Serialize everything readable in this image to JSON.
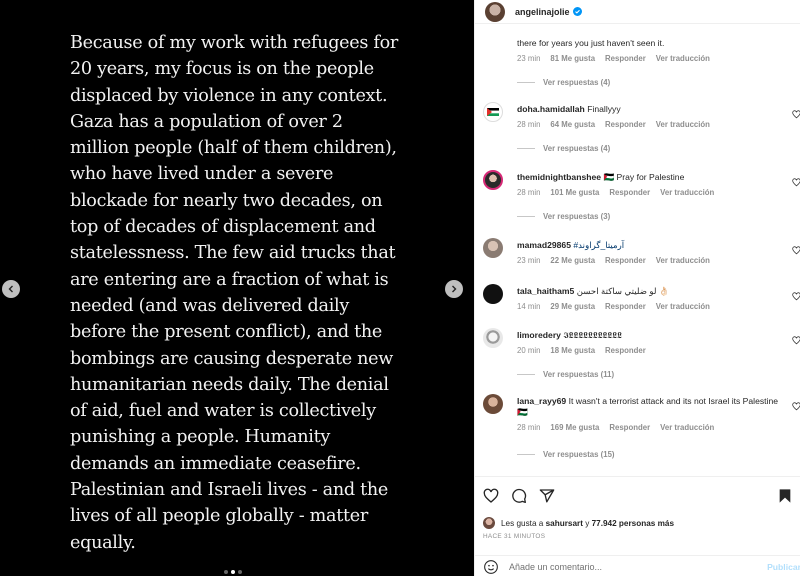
{
  "post": {
    "text": "Because of my work with refugees for 20 years, my focus is on the people displaced by violence in any context. Gaza has a population of over 2 million people (half of them children), who have lived under a severe blockade for nearly two decades, on top of decades of displacement and statelessness. The few aid trucks that are entering are a fraction of what is needed (and was delivered daily before the present conflict), and the bombings are causing desperate new humanitarian needs daily. The denial of aid, fuel and water is collectively punishing a people. Humanity demands an immediate ceasefire. Palestinian and Israeli lives - and the lives of all people globally - matter equally."
  },
  "header": {
    "username": "angelinajolie"
  },
  "labels": {
    "reply": "Responder",
    "translate": "Ver traducción"
  },
  "comments": [
    {
      "user": "",
      "text": "there for years you just haven't seen it.",
      "time": "23 min",
      "likes": "81 Me gusta",
      "translate": true,
      "replies": "Ver respuestas (4)"
    },
    {
      "user": "doha.hamidallah",
      "text": "Finallyyy",
      "time": "28 min",
      "likes": "64 Me gusta",
      "translate": true,
      "replies": "Ver respuestas (4)"
    },
    {
      "user": "themidnightbanshee",
      "text": "🇵🇸 Pray for Palestine",
      "time": "28 min",
      "likes": "101 Me gusta",
      "translate": true,
      "replies": "Ver respuestas (3)"
    },
    {
      "user": "mamad29865",
      "text": "#آرمیتا_گراوند",
      "time": "23 min",
      "likes": "22 Me gusta",
      "translate": true,
      "replies": ""
    },
    {
      "user": "tala_haitham5",
      "text": "لو ضليتي ساكتة احسن 👌🏻",
      "time": "14 min",
      "likes": "29 Me gusta",
      "translate": true,
      "replies": ""
    },
    {
      "user": "limoredery",
      "text": "𝕴𝕷𝕷𝕷𝕷𝕷𝕷𝕷𝕷𝕷𝕷𝕷",
      "time": "20 min",
      "likes": "18 Me gusta",
      "translate": false,
      "replies": "Ver respuestas (11)"
    },
    {
      "user": "lana_rayy69",
      "text": "It wasn't a terrorist attack and its not Israel its Palestine 🇵🇸",
      "time": "28 min",
      "likes": "169 Me gusta",
      "translate": true,
      "replies": "Ver respuestas (15)"
    }
  ],
  "likes_bar": {
    "prefix": "Les gusta a",
    "user": "sahursart",
    "middle": "y",
    "count": "77.942 personas más"
  },
  "time_ago": "HACE 31 MINUTOS",
  "add_comment": {
    "placeholder": "Añade un comentario...",
    "publish": "Publicar"
  },
  "icons": {
    "prev": "chevron-left-icon",
    "next": "chevron-right-icon",
    "verified": "verified-badge-icon",
    "like": "heart-icon",
    "comment": "comment-bubble-icon",
    "share": "send-icon",
    "save": "bookmark-icon",
    "emoji": "emoji-smile-icon"
  },
  "colors": {
    "verified": "#0095f6",
    "publish": "#b2dffc",
    "muted": "#8e8e8e"
  }
}
